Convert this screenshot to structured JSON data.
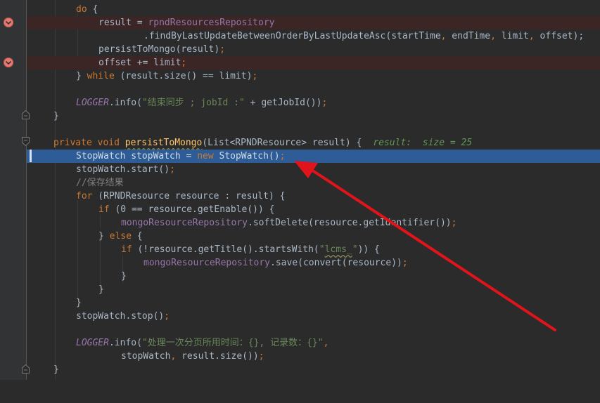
{
  "editor": {
    "theme": "darcula",
    "colors": {
      "background": "#2b2b2b",
      "breakpoint_line": "#3b2525",
      "current_line": "#2d5c97",
      "keyword": "#cc7832",
      "field": "#9876aa",
      "method_decl": "#ffc66d",
      "string": "#6a8759",
      "inline_value": "#629755",
      "annotation_arrow": "#e0141a"
    },
    "lines": [
      {
        "kind": "plain",
        "text": "do {"
      },
      {
        "kind": "breakpoint",
        "text": "result = rpndResourcesRepository"
      },
      {
        "kind": "plain",
        "text": ".findByLastUpdateBetweenOrderByLastUpdateAsc(startTime, endTime, limit, offset);"
      },
      {
        "kind": "plain",
        "text": "persistToMongo(result);"
      },
      {
        "kind": "breakpoint",
        "text": "offset += limit;"
      },
      {
        "kind": "plain",
        "text": "} while (result.size() == limit);"
      },
      {
        "kind": "plain",
        "text": "LOGGER.info(\"结束同步 ; jobId :\" + getJobId());"
      },
      {
        "kind": "plain",
        "text": "}"
      },
      {
        "kind": "plain",
        "text": "private void persistToMongo(List<RPNDResource> result) {"
      },
      {
        "kind": "current",
        "text": "StopWatch stopWatch = new StopWatch();"
      },
      {
        "kind": "plain",
        "text": "stopWatch.start();"
      },
      {
        "kind": "comment",
        "text": "//保存结果"
      },
      {
        "kind": "plain",
        "text": "for (RPNDResource resource : result) {"
      },
      {
        "kind": "plain",
        "text": "if (0 == resource.getEnable()) {"
      },
      {
        "kind": "plain",
        "text": "mongoResourceRepository.softDelete(resource.getIdentifier());"
      },
      {
        "kind": "plain",
        "text": "} else {"
      },
      {
        "kind": "plain",
        "text": "if (!resource.getTitle().startsWith(\"lcms_\")) {"
      },
      {
        "kind": "plain",
        "text": "mongoResourceRepository.save(convert(resource));"
      },
      {
        "kind": "plain",
        "text": "}"
      },
      {
        "kind": "plain",
        "text": "}"
      },
      {
        "kind": "plain",
        "text": "}"
      },
      {
        "kind": "plain",
        "text": "stopWatch.stop();"
      },
      {
        "kind": "plain",
        "text": "LOGGER.info(\"处理一次分页所用时间：{}, 记录数：{}\","
      },
      {
        "kind": "plain",
        "text": "stopWatch, result.size());"
      },
      {
        "kind": "plain",
        "text": "}"
      }
    ],
    "inline_debug_value": "result:  size = 25",
    "tokens": {
      "do": "do",
      "brace_open": " {",
      "result_var": "result",
      "assign": " = ",
      "repo": "rpndResourcesRepository",
      "find_call": ".findByLastUpdateBetweenOrderByLastUpdateAsc(startTime",
      "comma": ",",
      "end_time": " endTime",
      "limit_arg": " limit",
      "offset_arg": " offset);",
      "persist_call": "persistToMongo(result)",
      "semi": ";",
      "offset_stmt": "offset += limit",
      "close_brace": "}",
      "while_kw": " while",
      "while_cond": " (result.size() == limit)",
      "logger": "LOGGER",
      "info_open": ".info(",
      "str_end_sync": "\"结束同步 ; jobId :\"",
      "plus_jobid": " + getJobId())",
      "private": "private",
      "void": " void ",
      "method_name": "persistToMongo",
      "params": "(List<RPNDResource> result) {",
      "stopwatch_decl": "StopWatch stopWatch = ",
      "new": "new",
      "stopwatch_ctor": " StopWatch()",
      "start_call": "stopWatch.start()",
      "comment_save": "//保存结果",
      "for": "for",
      "for_body": " (RPNDResource resource : result) {",
      "if": "if",
      "if_enable": " (0 == resource.getEnable()) {",
      "mongo_repo": "mongoResourceRepository",
      "soft_delete": ".softDelete(resource.getIdentifier())",
      "else_open": "} ",
      "else": "else",
      "if_title": " (!resource.getTitle().startsWith(",
      "str_lcms_q1": "\"",
      "str_lcms": "lcms_",
      "str_lcms_q2": "\"",
      "if_title_end": ")) {",
      "save_call": ".save(convert(resource))",
      "stop_call": "stopWatch.stop()",
      "str_page_time": "\"处理一次分页所用时间：{}, 记录数：{}\"",
      "sw_arg": "stopWatch",
      "size_arg": " result.size())"
    }
  }
}
